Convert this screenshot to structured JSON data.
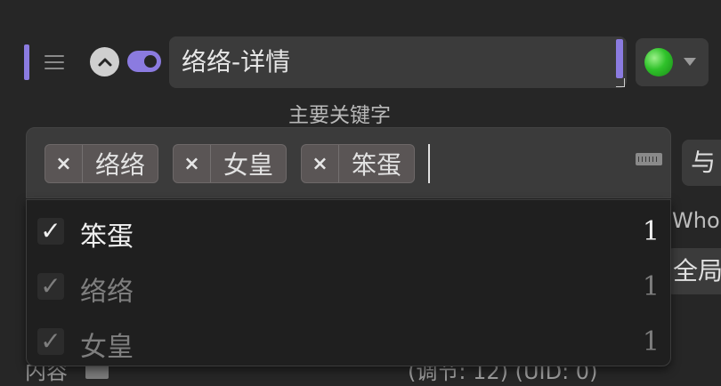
{
  "header": {
    "title_value": "络络-详情",
    "status_color": "#2fc22a"
  },
  "keywords": {
    "label": "主要关键字",
    "chips": [
      {
        "remove": "×",
        "label": "络络"
      },
      {
        "remove": "×",
        "label": "女皇"
      },
      {
        "remove": "×",
        "label": "笨蛋"
      }
    ]
  },
  "dropdown": {
    "options": [
      {
        "check": "✓",
        "label": "笨蛋",
        "count": "1",
        "state": "active"
      },
      {
        "check": "✓",
        "label": "络络",
        "count": "1",
        "state": "dim"
      },
      {
        "check": "✓",
        "label": "女皇",
        "count": "1",
        "state": "dim"
      }
    ]
  },
  "side": {
    "logic_select": "与 (",
    "who_text": "Who",
    "scope_select": "全局"
  },
  "footer": {
    "left_text": "内容",
    "right_text": "(调节: 12) (UID: 0)"
  },
  "colors": {
    "accent": "#8b7be0",
    "background": "#262626",
    "panel": "#3b3b3b"
  }
}
